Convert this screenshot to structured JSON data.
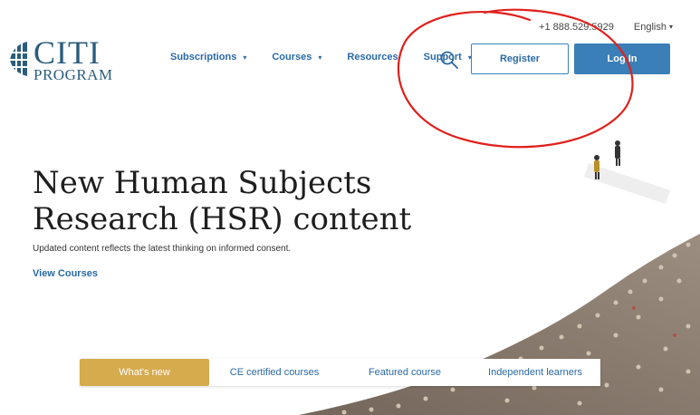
{
  "utility": {
    "phone": "+1 888.529.5929",
    "language": "English"
  },
  "logo": {
    "line1": "CITI",
    "line2": "PROGRAM"
  },
  "nav": {
    "items": [
      {
        "label": "Subscriptions",
        "has_dropdown": true
      },
      {
        "label": "Courses",
        "has_dropdown": true
      },
      {
        "label": "Resources",
        "has_dropdown": false
      },
      {
        "label": "Support",
        "has_dropdown": true
      }
    ],
    "search_icon": "search-icon",
    "register_label": "Register",
    "login_label": "Log In"
  },
  "hero": {
    "title": "New Human Subjects Research (HSR) content",
    "subtitle": "Updated content reflects the latest thinking on informed consent.",
    "link": "View Courses"
  },
  "tabs": [
    {
      "label": "What's new",
      "active": true
    },
    {
      "label": "CE certified courses",
      "active": false
    },
    {
      "label": "Featured course",
      "active": false
    },
    {
      "label": "Independent learners",
      "active": false
    }
  ],
  "colors": {
    "brand_blue": "#3a7fb7",
    "link_blue": "#2a6aa6",
    "active_tab": "#d6ab4e",
    "annotation": "#e0201c"
  }
}
